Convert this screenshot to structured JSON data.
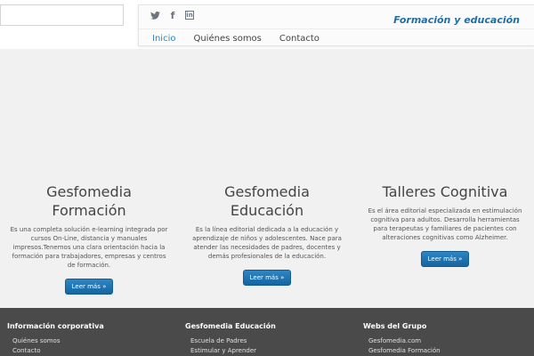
{
  "header": {
    "tagline": "Formación y educación",
    "social": [
      {
        "icon": "twitter-icon",
        "glyph": "🐦"
      },
      {
        "icon": "facebook-icon",
        "glyph": "f"
      },
      {
        "icon": "linkedin-icon",
        "glyph": "in"
      }
    ],
    "menu": [
      {
        "label": "Inicio",
        "active": true
      },
      {
        "label": "Quiénes somos",
        "active": false
      },
      {
        "label": "Contacto",
        "active": false
      }
    ]
  },
  "columns": [
    {
      "title_line1": "Gesfomedia",
      "title_line2": "Formación",
      "text": "Es una completa solución e-learning integrada por cursos On-Line, distancia y manuales impresos.Tenemos una clara orientación hacia la formación para trabajadores, empresas y centros de formación.",
      "button": "Leer más »"
    },
    {
      "title_line1": "Gesfomedia Educación",
      "title_line2": "",
      "text": "Es la línea editorial dedicada a la educación y aprendizaje de niños y adolescentes. Nace para atender las necesidades de padres, docentes y demás profesionales de la educación.",
      "button": "Leer más »"
    },
    {
      "title_line1": "Talleres Cognitiva",
      "title_line2": "",
      "text": "Es el área editorial especializada en estimulación cognitiva para adultos. Desarrolla herramientas para terapeutas y familiares de pacientes con alteraciones cognitivas como Alzheimer.",
      "button": "Leer más »"
    }
  ],
  "footer": {
    "columns": [
      {
        "title": "Información corporativa",
        "items": [
          "Quiénes somos",
          "Contacto"
        ]
      },
      {
        "title": "Gesfomedia Educación",
        "items": [
          "Escuela de Padres",
          "Estimular y Aprender"
        ]
      },
      {
        "title": "Webs del Grupo",
        "items": [
          "Gesfomedia.com",
          "Gesfomedia Formación"
        ]
      }
    ]
  },
  "colors": {
    "accent": "#2a87c5",
    "tagline": "#1f6fa6",
    "button": "#1a6aa8",
    "footer_bg": "#4a4a4a",
    "page_bg": "#f1f1f1"
  }
}
